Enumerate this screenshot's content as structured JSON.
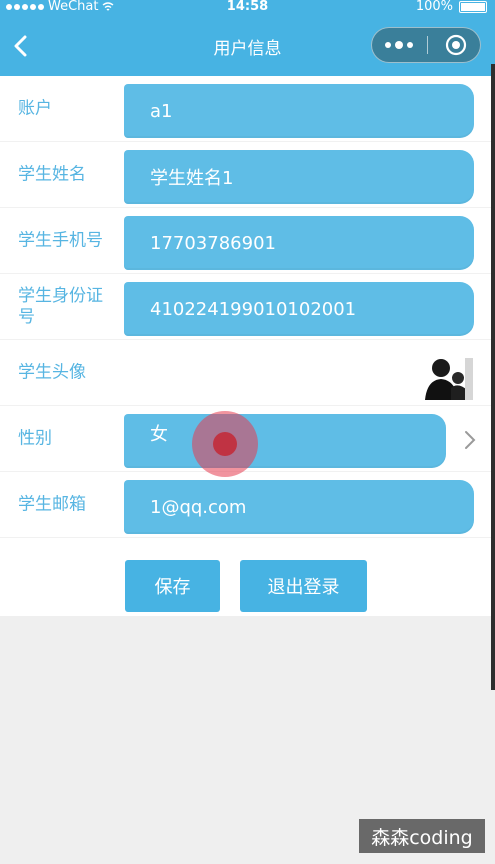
{
  "status_bar": {
    "carrier": "WeChat",
    "time": "14:58",
    "battery": "100%"
  },
  "nav": {
    "title": "用户信息",
    "back_icon": "chevron-left-icon",
    "more_icon": "more-dots-icon",
    "close_icon": "target-close-icon"
  },
  "form": {
    "account": {
      "label": "账户",
      "value": "a1"
    },
    "name": {
      "label": "学生姓名",
      "value": "学生姓名1"
    },
    "phone": {
      "label": "学生手机号",
      "value": "17703786901"
    },
    "id_card": {
      "label": "学生身份证号",
      "value": "410224199010102001"
    },
    "avatar": {
      "label": "学生头像",
      "icon": "avatar-photo"
    },
    "gender": {
      "label": "性别",
      "value": "女",
      "icon": "chevron-right-icon"
    },
    "email": {
      "label": "学生邮箱",
      "value": "1@qq.com"
    }
  },
  "buttons": {
    "save": "保存",
    "logout": "退出登录"
  },
  "watermark": "森森coding",
  "colors": {
    "brand": "#47b3e3",
    "field": "#5fbde6",
    "label": "#57b5e2",
    "background": "#efefef"
  }
}
